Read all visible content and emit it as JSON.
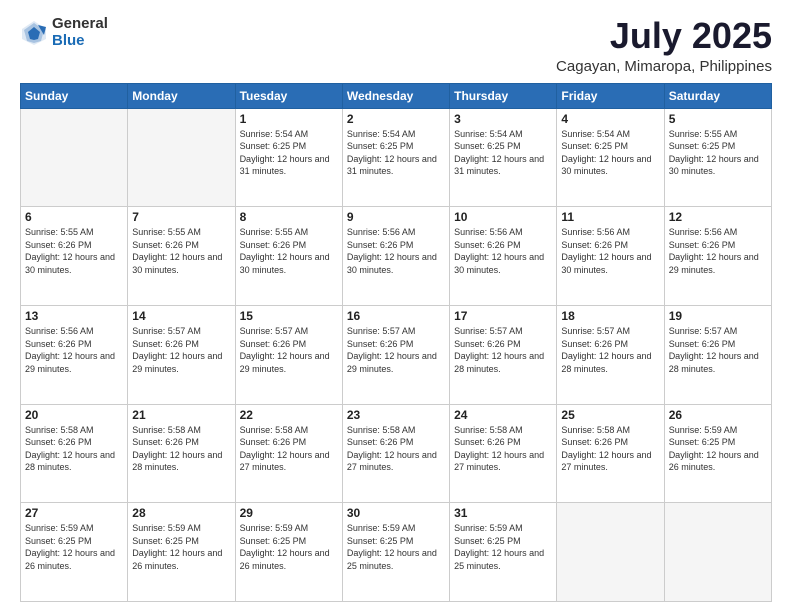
{
  "logo": {
    "general": "General",
    "blue": "Blue"
  },
  "header": {
    "title": "July 2025",
    "subtitle": "Cagayan, Mimaropa, Philippines"
  },
  "weekdays": [
    "Sunday",
    "Monday",
    "Tuesday",
    "Wednesday",
    "Thursday",
    "Friday",
    "Saturday"
  ],
  "weeks": [
    [
      {
        "day": "",
        "info": ""
      },
      {
        "day": "",
        "info": ""
      },
      {
        "day": "1",
        "info": "Sunrise: 5:54 AM\nSunset: 6:25 PM\nDaylight: 12 hours and 31 minutes."
      },
      {
        "day": "2",
        "info": "Sunrise: 5:54 AM\nSunset: 6:25 PM\nDaylight: 12 hours and 31 minutes."
      },
      {
        "day": "3",
        "info": "Sunrise: 5:54 AM\nSunset: 6:25 PM\nDaylight: 12 hours and 31 minutes."
      },
      {
        "day": "4",
        "info": "Sunrise: 5:54 AM\nSunset: 6:25 PM\nDaylight: 12 hours and 30 minutes."
      },
      {
        "day": "5",
        "info": "Sunrise: 5:55 AM\nSunset: 6:25 PM\nDaylight: 12 hours and 30 minutes."
      }
    ],
    [
      {
        "day": "6",
        "info": "Sunrise: 5:55 AM\nSunset: 6:26 PM\nDaylight: 12 hours and 30 minutes."
      },
      {
        "day": "7",
        "info": "Sunrise: 5:55 AM\nSunset: 6:26 PM\nDaylight: 12 hours and 30 minutes."
      },
      {
        "day": "8",
        "info": "Sunrise: 5:55 AM\nSunset: 6:26 PM\nDaylight: 12 hours and 30 minutes."
      },
      {
        "day": "9",
        "info": "Sunrise: 5:56 AM\nSunset: 6:26 PM\nDaylight: 12 hours and 30 minutes."
      },
      {
        "day": "10",
        "info": "Sunrise: 5:56 AM\nSunset: 6:26 PM\nDaylight: 12 hours and 30 minutes."
      },
      {
        "day": "11",
        "info": "Sunrise: 5:56 AM\nSunset: 6:26 PM\nDaylight: 12 hours and 30 minutes."
      },
      {
        "day": "12",
        "info": "Sunrise: 5:56 AM\nSunset: 6:26 PM\nDaylight: 12 hours and 29 minutes."
      }
    ],
    [
      {
        "day": "13",
        "info": "Sunrise: 5:56 AM\nSunset: 6:26 PM\nDaylight: 12 hours and 29 minutes."
      },
      {
        "day": "14",
        "info": "Sunrise: 5:57 AM\nSunset: 6:26 PM\nDaylight: 12 hours and 29 minutes."
      },
      {
        "day": "15",
        "info": "Sunrise: 5:57 AM\nSunset: 6:26 PM\nDaylight: 12 hours and 29 minutes."
      },
      {
        "day": "16",
        "info": "Sunrise: 5:57 AM\nSunset: 6:26 PM\nDaylight: 12 hours and 29 minutes."
      },
      {
        "day": "17",
        "info": "Sunrise: 5:57 AM\nSunset: 6:26 PM\nDaylight: 12 hours and 28 minutes."
      },
      {
        "day": "18",
        "info": "Sunrise: 5:57 AM\nSunset: 6:26 PM\nDaylight: 12 hours and 28 minutes."
      },
      {
        "day": "19",
        "info": "Sunrise: 5:57 AM\nSunset: 6:26 PM\nDaylight: 12 hours and 28 minutes."
      }
    ],
    [
      {
        "day": "20",
        "info": "Sunrise: 5:58 AM\nSunset: 6:26 PM\nDaylight: 12 hours and 28 minutes."
      },
      {
        "day": "21",
        "info": "Sunrise: 5:58 AM\nSunset: 6:26 PM\nDaylight: 12 hours and 28 minutes."
      },
      {
        "day": "22",
        "info": "Sunrise: 5:58 AM\nSunset: 6:26 PM\nDaylight: 12 hours and 27 minutes."
      },
      {
        "day": "23",
        "info": "Sunrise: 5:58 AM\nSunset: 6:26 PM\nDaylight: 12 hours and 27 minutes."
      },
      {
        "day": "24",
        "info": "Sunrise: 5:58 AM\nSunset: 6:26 PM\nDaylight: 12 hours and 27 minutes."
      },
      {
        "day": "25",
        "info": "Sunrise: 5:58 AM\nSunset: 6:26 PM\nDaylight: 12 hours and 27 minutes."
      },
      {
        "day": "26",
        "info": "Sunrise: 5:59 AM\nSunset: 6:25 PM\nDaylight: 12 hours and 26 minutes."
      }
    ],
    [
      {
        "day": "27",
        "info": "Sunrise: 5:59 AM\nSunset: 6:25 PM\nDaylight: 12 hours and 26 minutes."
      },
      {
        "day": "28",
        "info": "Sunrise: 5:59 AM\nSunset: 6:25 PM\nDaylight: 12 hours and 26 minutes."
      },
      {
        "day": "29",
        "info": "Sunrise: 5:59 AM\nSunset: 6:25 PM\nDaylight: 12 hours and 26 minutes."
      },
      {
        "day": "30",
        "info": "Sunrise: 5:59 AM\nSunset: 6:25 PM\nDaylight: 12 hours and 25 minutes."
      },
      {
        "day": "31",
        "info": "Sunrise: 5:59 AM\nSunset: 6:25 PM\nDaylight: 12 hours and 25 minutes."
      },
      {
        "day": "",
        "info": ""
      },
      {
        "day": "",
        "info": ""
      }
    ]
  ]
}
